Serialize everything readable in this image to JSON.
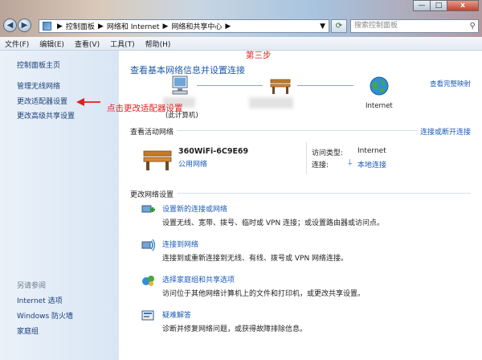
{
  "window": {
    "minimize": "—",
    "maximize": "□",
    "close": "x"
  },
  "address": {
    "crumbs": [
      "控制面板",
      "网络和 Internet",
      "网络和共享中心"
    ],
    "search_placeholder": "搜索控制面板"
  },
  "menu": [
    "文件(F)",
    "编辑(E)",
    "查看(V)",
    "工具(T)",
    "帮助(H)"
  ],
  "sidebar": {
    "home": "控制面板主页",
    "items": [
      "管理无线网络",
      "更改适配器设置",
      "更改高级共享设置"
    ],
    "see_also": "另请参阅",
    "see_also_items": [
      "Internet 选项",
      "Windows 防火墙",
      "家庭组"
    ]
  },
  "annotations": {
    "step": "第三步",
    "hint": "点击更改适配器设置"
  },
  "main": {
    "title": "查看基本网络信息并设置连接",
    "view_full_map": "查看完整映射",
    "map_nodes": {
      "this_computer": "(此计算机)",
      "internet": "Internet"
    },
    "active_networks_header": "查看活动网络",
    "connect_disconnect": "连接或断开连接",
    "network": {
      "name": "360WiFi-6C9E69",
      "type": "公用网络",
      "access_label": "访问类型:",
      "access_value": "Internet",
      "conn_label": "连接:",
      "conn_value": "本地连接"
    },
    "change_settings_header": "更改网络设置",
    "tasks": [
      {
        "title": "设置新的连接或网络",
        "desc": "设置无线、宽带、拨号、临时或 VPN 连接；或设置路由器或访问点。"
      },
      {
        "title": "连接到网络",
        "desc": "连接到或重新连接到无线、有线、拨号或 VPN 网络连接。"
      },
      {
        "title": "选择家庭组和共享选项",
        "desc": "访问位于其他网络计算机上的文件和打印机，或更改共享设置。"
      },
      {
        "title": "疑难解答",
        "desc": "诊断并修复网络问题，或获得故障排除信息。"
      }
    ]
  },
  "colors": {
    "link": "#1a5bb8",
    "annotation": "#e02020",
    "title": "#1c5aa6"
  }
}
